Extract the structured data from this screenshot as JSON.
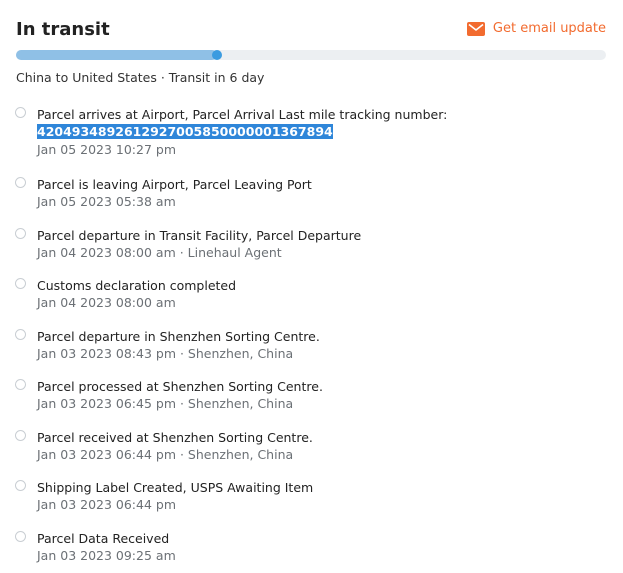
{
  "header": {
    "status_title": "In transit",
    "email_update_label": "Get email update",
    "route_text": "China to United States · Transit in 6 day"
  },
  "progress": {
    "fraction": 0.34
  },
  "events": [
    {
      "title": "Parcel arrives at Airport, Parcel Arrival Last mile tracking number:",
      "tracking_number": "420493489261292700585000000136789​4",
      "meta": "Jan 05 2023 10:27 pm"
    },
    {
      "title": "Parcel is leaving Airport, Parcel Leaving Port",
      "meta": "Jan 05 2023 05:38 am"
    },
    {
      "title": "Parcel departure in Transit Facility, Parcel Departure",
      "meta": "Jan 04 2023 08:00 am · Linehaul Agent"
    },
    {
      "title": "Customs declaration completed",
      "meta": "Jan 04 2023 08:00 am"
    },
    {
      "title": "Parcel departure in Shenzhen Sorting Centre.",
      "meta": "Jan 03 2023 08:43 pm · Shenzhen, China"
    },
    {
      "title": "Parcel processed at Shenzhen Sorting Centre.",
      "meta": "Jan 03 2023 06:45 pm · Shenzhen, China"
    },
    {
      "title": "Parcel received at Shenzhen Sorting Centre.",
      "meta": "Jan 03 2023 06:44 pm · Shenzhen, China"
    },
    {
      "title": "Shipping Label Created, USPS Awaiting Item",
      "meta": "Jan 03 2023 06:44 pm"
    },
    {
      "title": "Parcel Data Received",
      "meta": "Jan 03 2023 09:25 am"
    }
  ],
  "colors": {
    "accent_orange": "#f26b2f",
    "progress_fill": "#8fc0e6",
    "progress_dot": "#3b9be0",
    "highlight": "#2f86d9"
  }
}
